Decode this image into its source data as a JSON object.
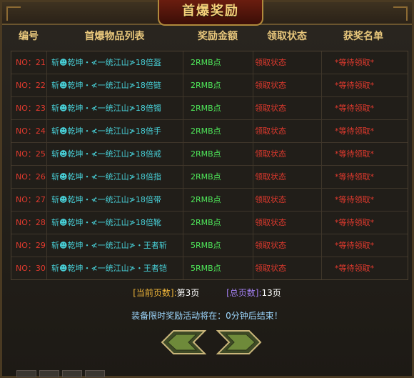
{
  "title": "首爆奖励",
  "headers": [
    "编号",
    "首爆物品列表",
    "奖励金额",
    "领取状态",
    "获奖名单"
  ],
  "rows": [
    {
      "no": "NO：21",
      "item": "斩☻乾坤・≮一统江山≯18倍盔",
      "amount": "2RMB点",
      "status": "领取状态",
      "winner": "*等待领取*"
    },
    {
      "no": "NO：22",
      "item": "斩☻乾坤・≮一统江山≯18倍链",
      "amount": "2RMB点",
      "status": "领取状态",
      "winner": "*等待领取*"
    },
    {
      "no": "NO：23",
      "item": "斩☻乾坤・≮一统江山≯18倍镯",
      "amount": "2RMB点",
      "status": "领取状态",
      "winner": "*等待领取*"
    },
    {
      "no": "NO：24",
      "item": "斩☻乾坤・≮一统江山≯18倍手",
      "amount": "2RMB点",
      "status": "领取状态",
      "winner": "*等待领取*"
    },
    {
      "no": "NO：25",
      "item": "斩☻乾坤・≮一统江山≯18倍戒",
      "amount": "2RMB点",
      "status": "领取状态",
      "winner": "*等待领取*"
    },
    {
      "no": "NO：26",
      "item": "斩☻乾坤・≮一统江山≯18倍指",
      "amount": "2RMB点",
      "status": "领取状态",
      "winner": "*等待领取*"
    },
    {
      "no": "NO：27",
      "item": "斩☻乾坤・≮一统江山≯18倍带",
      "amount": "2RMB点",
      "status": "领取状态",
      "winner": "*等待领取*"
    },
    {
      "no": "NO：28",
      "item": "斩☻乾坤・≮一统江山≯18倍靴",
      "amount": "2RMB点",
      "status": "领取状态",
      "winner": "*等待领取*"
    },
    {
      "no": "NO：29",
      "item": "斩☻乾坤・≮一统江山≯・王者斩",
      "amount": "5RMB点",
      "status": "领取状态",
      "winner": "*等待领取*"
    },
    {
      "no": "NO：30",
      "item": "斩☻乾坤・≮一统江山≯・王者铠",
      "amount": "5RMB点",
      "status": "领取状态",
      "winner": "*等待领取*"
    }
  ],
  "pager": {
    "current_label": "[当前页数]:",
    "current": "第3页",
    "total_label": "[总页数]:",
    "total": "13页"
  },
  "notice": "装备限时奖励活动将在：0分钟后结束！",
  "colors": {
    "id": "#e23a2e",
    "item": "#48d0d8",
    "amount": "#4fe85a",
    "status": "#e23a2e",
    "header": "#e8c77c",
    "title": "#f6d17a"
  }
}
